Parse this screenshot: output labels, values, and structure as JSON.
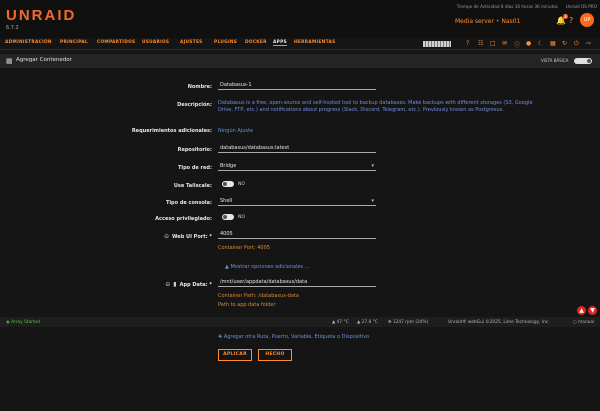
{
  "header": {
    "brand": "UNRAID",
    "version": "6.7.2",
    "uptime_note": "Tiempo de Actividad 8 días 16 horas 36 minutos",
    "unraid_note": "Unraid OS PRO",
    "server_label": "Media server",
    "server_name": "Nas01",
    "notification_count": "3"
  },
  "nav": {
    "items": [
      "ADMINISTRACIÓN",
      "PRINCIPAL",
      "COMPARTIDOS",
      "USUARIOS",
      "AJUSTES",
      "PLUGINS",
      "DOCKER",
      "APPS",
      "HERRAMIENTAS"
    ],
    "active": "APPS"
  },
  "page": {
    "title": "Agregar Contenedor",
    "view_label": "VISTA BÁSICA"
  },
  "form": {
    "name_label": "Nombre:",
    "name_value": "Databasus-1",
    "description_label": "Descripción:",
    "description_text": "Databasus is a free, open-source and self-hosted tool to backup databases. Make backups with different storages (S3, Google Drive, FTP, etc.) and notifications about progress (Slack, Discord, Telegram, etc.). Previously known as Postgresus.",
    "requirements_label": "Requerimientos adicionales:",
    "requirements_value": "Ningún Ajuste",
    "repository_label": "Repositorio:",
    "repository_value": "databasus/databasus:latest",
    "network_label": "Tipo de red:",
    "network_value": "Bridge",
    "tailscale_label": "Use Tailscale:",
    "tailscale_value": "NO",
    "console_label": "Tipo de consola:",
    "console_value": "Shell",
    "privileged_label": "Acceso privilegiado:",
    "privileged_value": "NO",
    "webui_label": "Web UI Port: *",
    "webui_value": "4005",
    "webui_sub": "Container Port: 4005",
    "more_settings": "Mostrar opciones adicionales ...",
    "appdata_label": "App Data: *",
    "appdata_value": "/mnt/user/appdata/databasus/data",
    "appdata_sub1": "Container Path: /databasus-data",
    "appdata_sub2": "Path to app data folder",
    "add_another": "Agregar otra Ruta, Puerto, Variable, Etiqueta o Dispositivo"
  },
  "status": {
    "array": "Array Started",
    "temp1": "47 °C",
    "temp2": "27.8 °C",
    "fan": "1247 rpm (24%)",
    "copyright": "Unraid® webGui ©2025, Lime Technology, Inc.",
    "manual": "manual"
  },
  "buttons": {
    "apply": "APLICAR",
    "done": "HECHO"
  },
  "colors": {
    "accent": "#ff8c2f",
    "link": "#6e8fde",
    "status_green": "#5fbf4a",
    "danger": "#e5261c"
  }
}
